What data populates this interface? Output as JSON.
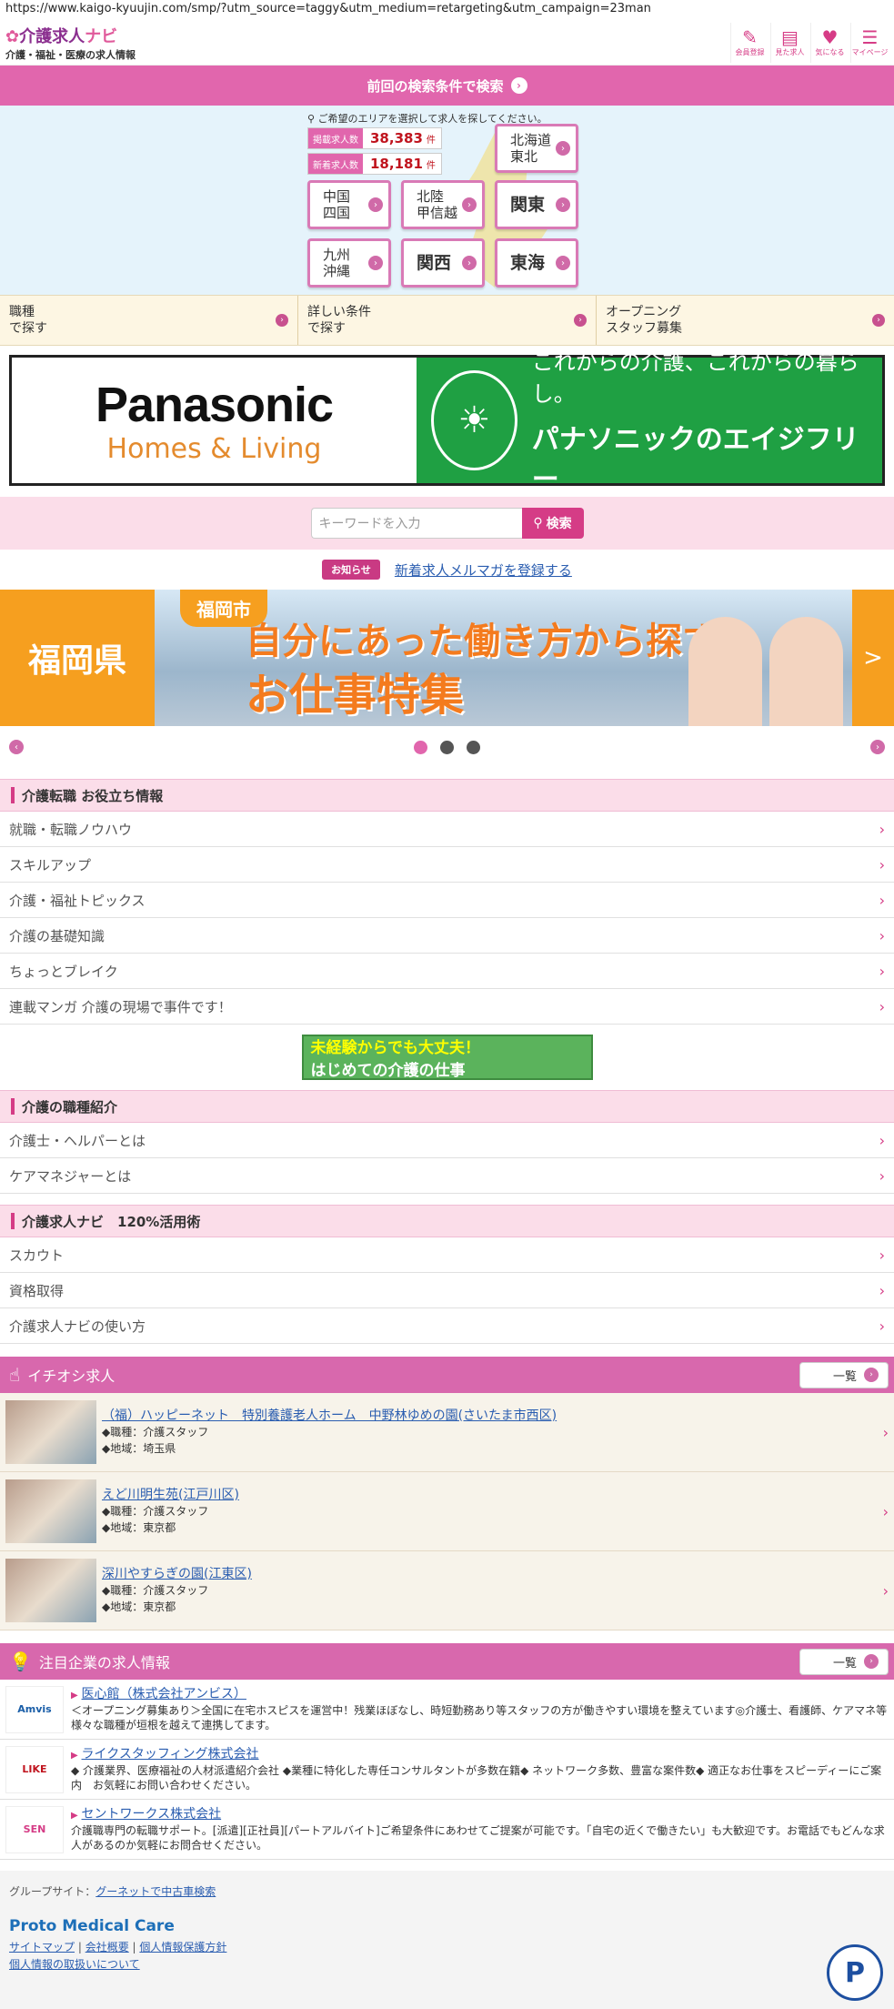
{
  "url": "https://www.kaigo-kyuujin.com/smp/?utm_source=taggy&utm_medium=retargeting&utm_campaign=23man",
  "header": {
    "logo_main": "介護求人",
    "logo_accent": "ナビ",
    "logo_sub": "介護・福祉・医療の求人情報",
    "icons": [
      {
        "label": "会員登録",
        "icon": "pencil-icon",
        "glyph": "✎"
      },
      {
        "label": "見た求人",
        "icon": "calendar-icon",
        "glyph": "▤"
      },
      {
        "label": "気になる",
        "icon": "heart-icon",
        "glyph": "♥"
      },
      {
        "label": "マイページ",
        "icon": "profile-icon",
        "glyph": "☰"
      }
    ]
  },
  "prev_search": {
    "label": "前回の検索条件で検索"
  },
  "area": {
    "note": "ご希望のエリアを選択して求人を探してください。",
    "stats": [
      {
        "label": "掲載求人数",
        "value": "38,383",
        "unit": "件"
      },
      {
        "label": "新着求人数",
        "value": "18,181",
        "unit": "件"
      }
    ],
    "regions": {
      "hokkaido": "北海道\n東北",
      "chugoku": "中国\n四国",
      "hokuriku": "北陸\n甲信越",
      "kanto": "関東",
      "kyushu": "九州\n沖縄",
      "kansai": "関西",
      "tokai": "東海"
    }
  },
  "tabs": [
    "職種\nで探す",
    "詳しい条件\nで探す",
    "オープニング\nスタッフ募集"
  ],
  "ad": {
    "brand": "Panasonic",
    "sub": "Homes & Living",
    "tagline": "これからの介護、これからの暮らし。",
    "company": "パナソニックのエイジフリー"
  },
  "search": {
    "placeholder": "キーワードを入力",
    "button": "検索"
  },
  "news": {
    "badge": "お知らせ",
    "link": "新着求人メルマガを登録する"
  },
  "banner": {
    "pref": "福岡県",
    "city": "福岡市",
    "line1": "自分にあった働き方から探す",
    "line2": "お仕事特集",
    "next": ">"
  },
  "sections": [
    {
      "title": "介護転職 お役立ち情報",
      "items": [
        "就職・転職ノウハウ",
        "スキルアップ",
        "介護・福祉トピックス",
        "介護の基礎知識",
        "ちょっとブレイク",
        "連載マンガ 介護の現場で事件です！"
      ]
    },
    {
      "title": "介護の職種紹介",
      "items": [
        "介護士・ヘルパーとは",
        "ケアマネジャーとは"
      ]
    },
    {
      "title": "介護求人ナビ　120%活用術",
      "items": [
        "スカウト",
        "資格取得",
        "介護求人ナビの使い方"
      ]
    }
  ],
  "mikeiken": {
    "line1": "未経験からでも大丈夫！",
    "line2": "はじめての介護の仕事"
  },
  "pickup": {
    "title": "イチオシ求人",
    "all": "一覧",
    "jobs": [
      {
        "name": "（福）ハッピーネット　特別養護老人ホーム　中野林ゆめの園(さいたま市西区)",
        "role": "◆職種：介護スタッフ",
        "region": "◆地域：埼玉県"
      },
      {
        "name": "えど川明生苑(江戸川区)",
        "role": "◆職種：介護スタッフ",
        "region": "◆地域：東京都"
      },
      {
        "name": "深川やすらぎの園(江東区)",
        "role": "◆職種：介護スタッフ",
        "region": "◆地域：東京都"
      }
    ]
  },
  "companies": {
    "title": "注目企業の求人情報",
    "all": "一覧",
    "items": [
      {
        "logo": "Amvis",
        "name": "医心館（株式会社アンビス）",
        "desc": "＜オープニング募集あり＞全国に在宅ホスピスを運営中！残業ほぼなし、時短勤務あり等スタッフの方が働きやすい環境を整えています◎介護士、看護師、ケアマネ等様々な職種が垣根を越えて連携してます。"
      },
      {
        "logo": "LIKE",
        "name": "ライクスタッフィング株式会社",
        "desc": "◆ 介護業界、医療福祉の人材派遣紹介会社 ◆業種に特化した専任コンサルタントが多数在籍◆ ネットワーク多数、豊富な案件数◆ 適正なお仕事をスピーディーにご案内　お気軽にお問い合わせください。"
      },
      {
        "logo": "SEN",
        "name": "セントワークス株式会社",
        "desc": "介護職専門の転職サポート。[派遣][正社員][パートアルバイト]ご希望条件にあわせてご提案が可能です。「自宅の近くで働きたい」も大歓迎です。お電話でもどんな求人があるのか気軽にお問合せください。"
      }
    ]
  },
  "footer": {
    "group_label": "グループサイト：",
    "group_link": "グーネットで中古車検索",
    "company": "Proto Medical Care",
    "links": [
      "サイトマップ",
      "会社概要",
      "個人情報保護方針",
      "個人情報の取扱いについて"
    ],
    "privacy_mark": "P"
  },
  "colors": {
    "accent": "#e166ad",
    "pink_dark": "#d53c86",
    "banner_orange": "#f69f1f",
    "ad_green": "#1fa043"
  }
}
